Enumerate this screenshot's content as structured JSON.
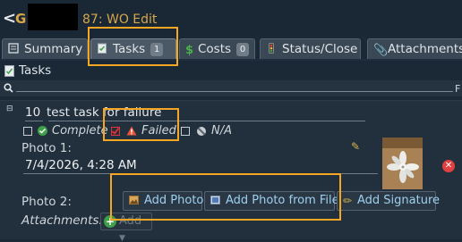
{
  "header": {
    "back_label": "<",
    "title_prefix": "G",
    "title": "87: WO Edit"
  },
  "tabs": [
    {
      "label": "Summary",
      "icon": "summary-icon"
    },
    {
      "label": "Tasks",
      "icon": "tasks-icon",
      "badge": "1",
      "active": true
    },
    {
      "label": "Costs",
      "icon": "dollar-icon",
      "badge": "0"
    },
    {
      "label": "Status/Close",
      "icon": "traffic-light-icon"
    },
    {
      "label": "Attachments",
      "icon": "paperclip-icon"
    }
  ],
  "tasks_section": {
    "title": "Tasks",
    "filter_label": "F"
  },
  "task": {
    "number": "10",
    "name": "test task for failure",
    "status_options": {
      "complete": "Complete",
      "failed": "Failed",
      "na": "N/A"
    },
    "failed_checked": true,
    "photo1_label": "Photo 1:",
    "photo1_date": "7/4/2026, 4:28 AM",
    "photo2_label": "Photo 2:",
    "attachments_label": "Attachments:",
    "buttons": {
      "add_photo": "Add Photo",
      "add_photo_from_file": "Add Photo from File",
      "add_signature": "Add Signature",
      "add": "Add"
    }
  },
  "colors": {
    "highlight": "#f5a623",
    "title_accent": "#d6a64a",
    "link_blue": "#9fd0ee",
    "failed_red": "#e0333a"
  }
}
